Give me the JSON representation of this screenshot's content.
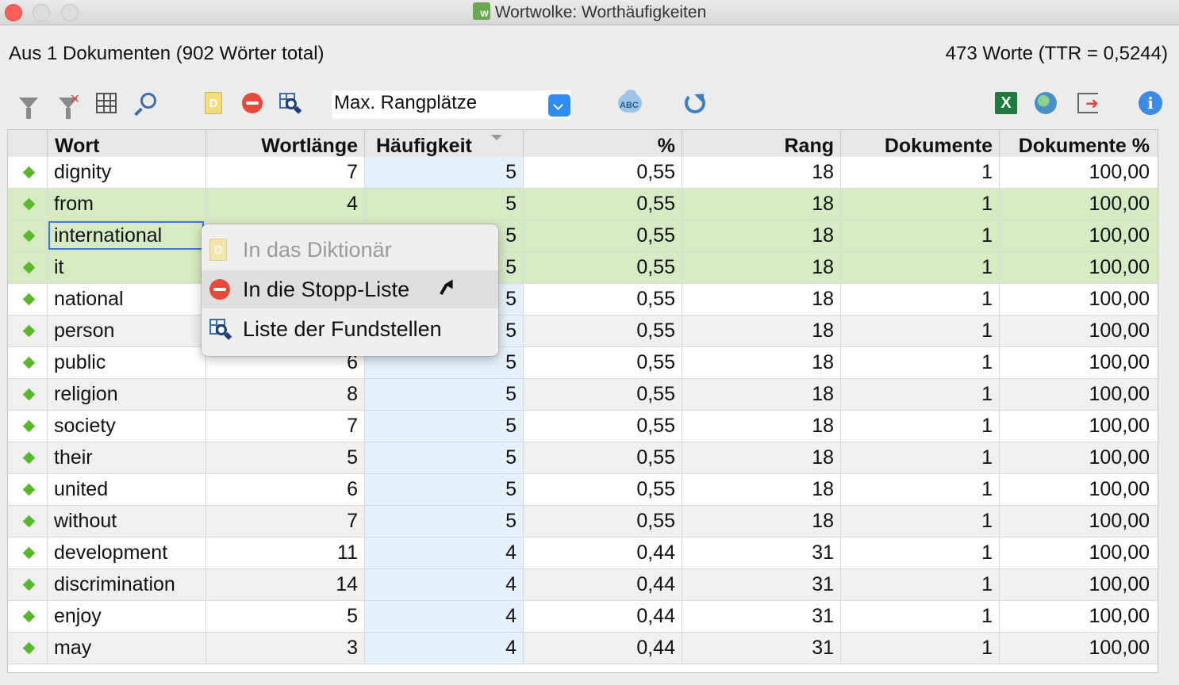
{
  "window": {
    "title": "Wortwolke: Worthäufigkeiten",
    "title_icon": "word-cloud-icon"
  },
  "summary": {
    "left": "Aus 1 Dokumenten (902 Wörter total)",
    "right": "473 Worte (TTR = 0,5244)"
  },
  "toolbar": {
    "select_value": "Max. Rangplätze",
    "icons": [
      "filter-icon",
      "clear-filter-icon",
      "columns-icon",
      "search-icon",
      "dictionary-icon",
      "stop-list-icon",
      "find-occurrences-icon",
      "dropdown-icon",
      "spellcheck-cloud-icon",
      "refresh-icon",
      "excel-export-icon",
      "web-export-icon",
      "export-icon",
      "info-icon"
    ]
  },
  "table": {
    "columns": [
      "",
      "Wort",
      "Wortlänge",
      "Häufigkeit",
      "%",
      "Rang",
      "Dokumente",
      "Dokumente %"
    ],
    "sorted_column": "Häufigkeit",
    "rows": [
      {
        "word": "dignity",
        "length": "7",
        "freq": "5",
        "pct": "0,55",
        "rank": "18",
        "docs": "1",
        "docs_pct": "100,00",
        "selected": false
      },
      {
        "word": "from",
        "length": "4",
        "freq": "5",
        "pct": "0,55",
        "rank": "18",
        "docs": "1",
        "docs_pct": "100,00",
        "selected": true
      },
      {
        "word": "international",
        "length": "",
        "freq": "5",
        "pct": "0,55",
        "rank": "18",
        "docs": "1",
        "docs_pct": "100,00",
        "selected": true
      },
      {
        "word": "it",
        "length": "",
        "freq": "5",
        "pct": "0,55",
        "rank": "18",
        "docs": "1",
        "docs_pct": "100,00",
        "selected": true
      },
      {
        "word": "national",
        "length": "",
        "freq": "5",
        "pct": "0,55",
        "rank": "18",
        "docs": "1",
        "docs_pct": "100,00",
        "selected": false
      },
      {
        "word": "person",
        "length": "",
        "freq": "5",
        "pct": "0,55",
        "rank": "18",
        "docs": "1",
        "docs_pct": "100,00",
        "selected": false
      },
      {
        "word": "public",
        "length": "6",
        "freq": "5",
        "pct": "0,55",
        "rank": "18",
        "docs": "1",
        "docs_pct": "100,00",
        "selected": false
      },
      {
        "word": "religion",
        "length": "8",
        "freq": "5",
        "pct": "0,55",
        "rank": "18",
        "docs": "1",
        "docs_pct": "100,00",
        "selected": false
      },
      {
        "word": "society",
        "length": "7",
        "freq": "5",
        "pct": "0,55",
        "rank": "18",
        "docs": "1",
        "docs_pct": "100,00",
        "selected": false
      },
      {
        "word": "their",
        "length": "5",
        "freq": "5",
        "pct": "0,55",
        "rank": "18",
        "docs": "1",
        "docs_pct": "100,00",
        "selected": false
      },
      {
        "word": "united",
        "length": "6",
        "freq": "5",
        "pct": "0,55",
        "rank": "18",
        "docs": "1",
        "docs_pct": "100,00",
        "selected": false
      },
      {
        "word": "without",
        "length": "7",
        "freq": "5",
        "pct": "0,55",
        "rank": "18",
        "docs": "1",
        "docs_pct": "100,00",
        "selected": false
      },
      {
        "word": "development",
        "length": "11",
        "freq": "4",
        "pct": "0,44",
        "rank": "31",
        "docs": "1",
        "docs_pct": "100,00",
        "selected": false
      },
      {
        "word": "discrimination",
        "length": "14",
        "freq": "4",
        "pct": "0,44",
        "rank": "31",
        "docs": "1",
        "docs_pct": "100,00",
        "selected": false
      },
      {
        "word": "enjoy",
        "length": "5",
        "freq": "4",
        "pct": "0,44",
        "rank": "31",
        "docs": "1",
        "docs_pct": "100,00",
        "selected": false
      },
      {
        "word": "may",
        "length": "3",
        "freq": "4",
        "pct": "0,44",
        "rank": "31",
        "docs": "1",
        "docs_pct": "100,00",
        "selected": false
      }
    ]
  },
  "context_menu": {
    "items": [
      {
        "label": "In das Diktionär",
        "icon": "dictionary-icon",
        "disabled": true
      },
      {
        "label": "In die Stopp-Liste",
        "icon": "stop-list-icon",
        "disabled": false,
        "hovered": true
      },
      {
        "label": "Liste der Fundstellen",
        "icon": "find-occurrences-icon",
        "disabled": false
      }
    ]
  },
  "colors": {
    "selected_row": "#d6eac4",
    "sorted_column": "#e6f0fb",
    "alt_row": "#f0f0f0",
    "diamond": "#58b82a",
    "accent": "#2f8cf5"
  }
}
